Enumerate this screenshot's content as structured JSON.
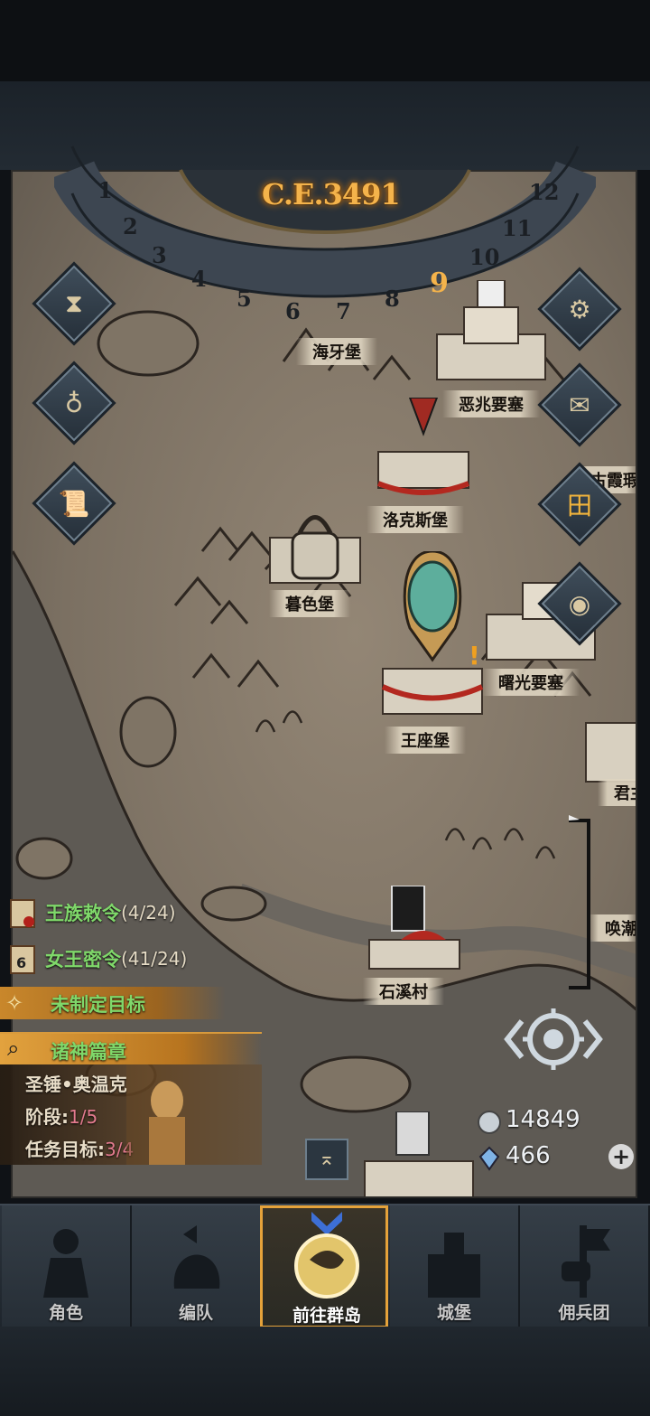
{
  "calendar": {
    "year": "C.E.3491",
    "months": [
      "1",
      "2",
      "3",
      "4",
      "5",
      "6",
      "7",
      "8",
      "9",
      "10",
      "11",
      "12"
    ],
    "current_month": "9"
  },
  "locations": [
    {
      "id": "haiyabao",
      "name": "海牙堡"
    },
    {
      "id": "ezhaoyaosai",
      "name": "恶兆要塞"
    },
    {
      "id": "gu",
      "name": "古霞瑕"
    },
    {
      "id": "luokesi",
      "name": "洛克斯堡"
    },
    {
      "id": "musebao",
      "name": "暮色堡"
    },
    {
      "id": "shuguang",
      "name": "曙光要塞"
    },
    {
      "id": "wangzuobao",
      "name": "王座堡"
    },
    {
      "id": "jun",
      "name": "君主"
    },
    {
      "id": "huanchao",
      "name": "唤潮"
    },
    {
      "id": "shixicun",
      "name": "石溪村"
    }
  ],
  "quests": [
    {
      "title": "王族敕令",
      "count": "(4/24)",
      "icon": "scroll-icon"
    },
    {
      "title": "女王密令",
      "count": "(41/24)",
      "icon": "scroll-6-icon",
      "badge": "6"
    }
  ],
  "goal": {
    "label": "未制定目标"
  },
  "chapter": {
    "title": "诸神篇章",
    "hero": "圣锤•奥温克",
    "stage_label": "阶段:",
    "stage_value": "1/5",
    "task_label": "任务目标:",
    "task_value": "3/4"
  },
  "resources": {
    "silver": "14849",
    "crystal": "466"
  },
  "tabs": [
    {
      "id": "character",
      "label": "角色",
      "icon": "knight-icon"
    },
    {
      "id": "formation",
      "label": "编队",
      "icon": "helmet-icon"
    },
    {
      "id": "islands",
      "label": "前往群岛",
      "icon": "globe-icon",
      "active": true
    },
    {
      "id": "castle",
      "label": "城堡",
      "icon": "castle-icon"
    },
    {
      "id": "mercenary",
      "label": "佣兵团",
      "icon": "flag-fist-icon"
    }
  ],
  "colors": {
    "accent": "#e5a23a",
    "year": "#f4b34b",
    "quest_green": "#7fd86a",
    "progress_pink": "#e27a8e"
  }
}
